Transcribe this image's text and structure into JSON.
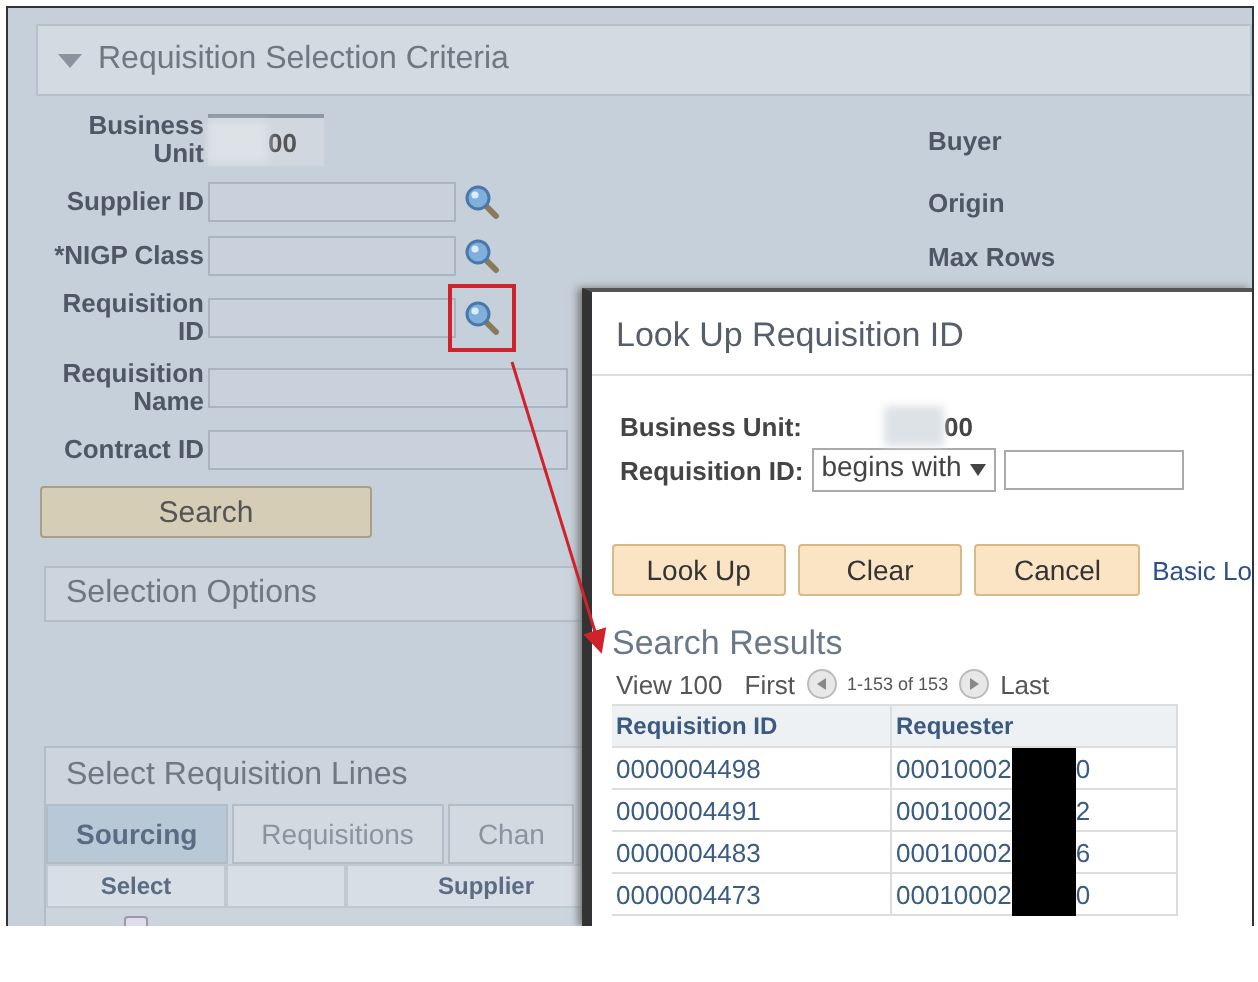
{
  "criteria": {
    "title": "Requisition Selection Criteria",
    "expanded": true,
    "fields": [
      {
        "label": "Business Unit",
        "kind": "value",
        "value": "00"
      },
      {
        "label": "Supplier ID",
        "kind": "lookup",
        "highlighted": false
      },
      {
        "label": "*NIGP Class",
        "kind": "lookup",
        "highlighted": false
      },
      {
        "label": "Requisition ID",
        "kind": "lookup",
        "highlighted": true
      },
      {
        "label": "Requisition Name",
        "kind": "wide"
      },
      {
        "label": "Contract ID",
        "kind": "wide"
      }
    ],
    "right_labels": [
      "Buyer",
      "Origin",
      "Max Rows"
    ],
    "search_button": "Search"
  },
  "selection_options": {
    "title": "Selection Options"
  },
  "lines": {
    "title": "Select Requisition Lines",
    "tabs": [
      {
        "label": "Sourcing",
        "selected": true
      },
      {
        "label": "Requisitions",
        "selected": false
      },
      {
        "label": "Chan",
        "selected": false
      }
    ],
    "columns": [
      "Select",
      "",
      "Supplier"
    ],
    "rows": [
      {
        "checked": false
      }
    ]
  },
  "lookup": {
    "title": "Look Up Requisition ID",
    "business_unit_label": "Business Unit:",
    "business_unit_value": "00",
    "requisition_label": "Requisition ID:",
    "operator": "begins with",
    "buttons": [
      "Look Up",
      "Clear",
      "Cancel"
    ],
    "link": "Basic Lo",
    "results_title": "Search Results",
    "nav": {
      "view": "View 100",
      "first": "First",
      "range": "1-153 of 153",
      "last": "Last"
    },
    "columns": [
      "Requisition ID",
      "Requester"
    ],
    "rows": [
      {
        "id": "0000004498",
        "requester": "00010002",
        "requester_end": "0"
      },
      {
        "id": "0000004491",
        "requester": "00010002",
        "requester_end": "2"
      },
      {
        "id": "0000004483",
        "requester": "00010002",
        "requester_end": "6"
      },
      {
        "id": "0000004473",
        "requester": "00010002",
        "requester_end": "0"
      }
    ]
  }
}
